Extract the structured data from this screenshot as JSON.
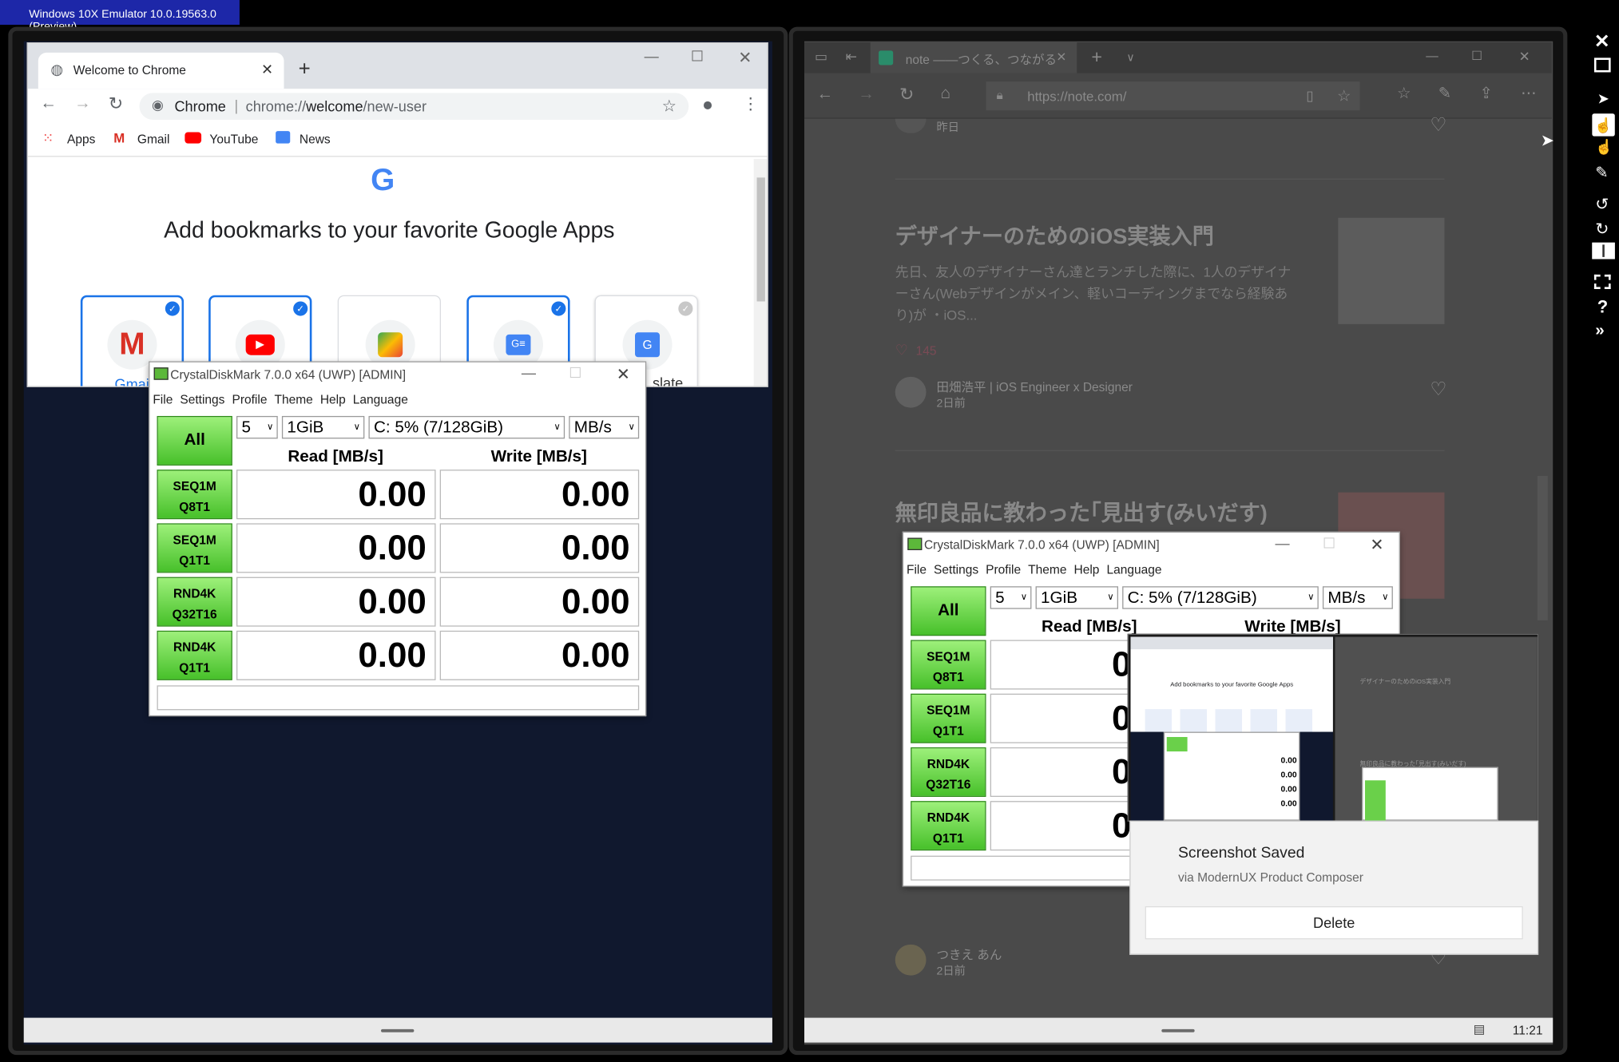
{
  "emulator": {
    "title": "Windows 10X Emulator 10.0.19563.0 (Preview)"
  },
  "chrome": {
    "tab_title": "Welcome to Chrome",
    "omni_label": "Chrome",
    "url_base": "chrome://",
    "url_bold": "welcome",
    "url_rest": "/new-user",
    "bookmarks": [
      "Apps",
      "Gmail",
      "YouTube",
      "News"
    ],
    "heading": "Add bookmarks to your favorite Google Apps",
    "apps": [
      "Gmail",
      "YouTube",
      "Maps",
      "News",
      "Translate"
    ],
    "visible_app_labels": [
      "Gmai",
      "slate"
    ]
  },
  "cdm": {
    "title": "CrystalDiskMark 7.0.0 x64 (UWP) [ADMIN]",
    "menu": [
      "File",
      "Settings",
      "Profile",
      "Theme",
      "Help",
      "Language"
    ],
    "all_label": "All",
    "count": "5",
    "size": "1GiB",
    "drive": "C: 5% (7/128GiB)",
    "unit": "MB/s",
    "read_header": "Read [MB/s]",
    "write_header": "Write [MB/s]",
    "rows": [
      {
        "l1": "SEQ1M",
        "l2": "Q8T1",
        "read": "0.00",
        "write": "0.00"
      },
      {
        "l1": "SEQ1M",
        "l2": "Q1T1",
        "read": "0.00",
        "write": "0.00"
      },
      {
        "l1": "RND4K",
        "l2": "Q32T16",
        "read": "0.00",
        "write": "0.00"
      },
      {
        "l1": "RND4K",
        "l2": "Q1T1",
        "read": "0.00",
        "write": "0.00"
      }
    ]
  },
  "edge": {
    "tab_title": "note ——つくる、つながる",
    "url": "https://note.com/",
    "partial_time": "昨日",
    "article1_title": "デザイナーのためのiOS実装入門",
    "article1_excerpt": "先日、友人のデザイナーさん達とランチした際に、1人のデザイナーさん(Webデザインがメイン、軽いコーディングまでなら経験あり)が ・iOS...",
    "likes": "145",
    "author1": "田畑浩平 | iOS Engineer x Designer",
    "author1_time": "2日前",
    "article2_title": "無印良品に教わった｢見出す(みいだす)",
    "author2": "つきえ あん",
    "author2_time": "2日前"
  },
  "thumb": {
    "heading": "Add bookmarks to your favorite Google Apps",
    "values": [
      "0.00",
      "0.00",
      "0.00",
      "0.00"
    ],
    "article_title": "デザイナーのためのiOS実装入門",
    "article2": "無印良品に教わった｢見出す(みいだす)"
  },
  "toast": {
    "title": "Screenshot Saved",
    "subtitle": "via ModernUX Product Composer",
    "button": "Delete"
  },
  "taskbar": {
    "time": "11:21"
  },
  "sidebar_icons": [
    "close-icon",
    "minimize-icon",
    "pointer-icon",
    "touch-icon",
    "multi-touch-icon",
    "pen-icon",
    "rotate-left-icon",
    "rotate-right-icon",
    "dual-screen-icon",
    "screenshot-icon",
    "help-icon",
    "expand-icon"
  ]
}
